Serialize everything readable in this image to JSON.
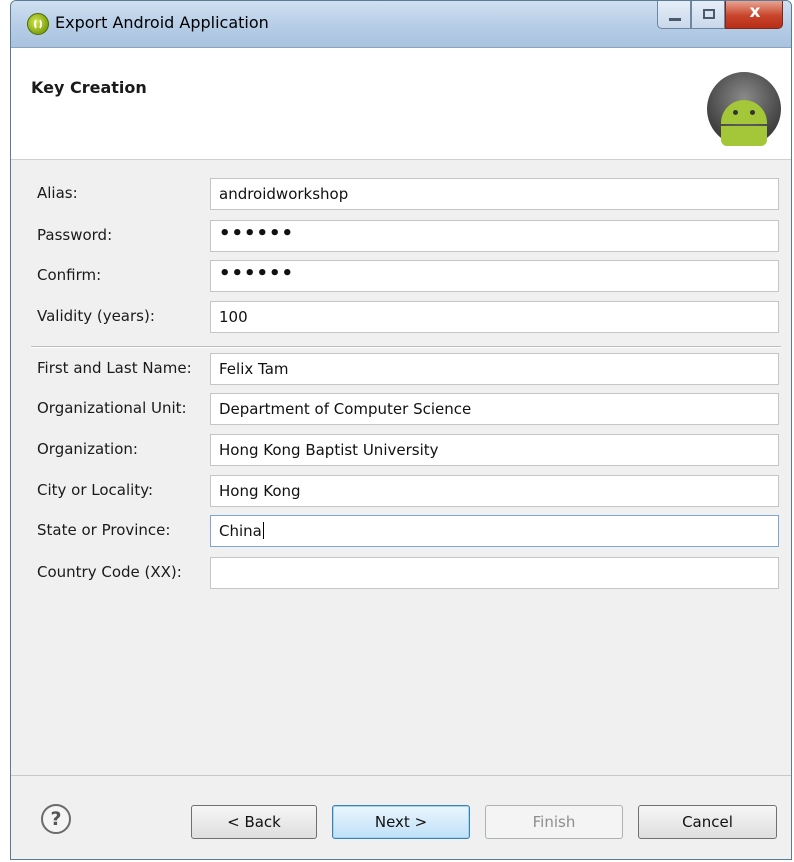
{
  "window": {
    "title": "Export Android Application",
    "icon": "android-eclipse-icon",
    "controls": {
      "minimize": "minimize-icon",
      "maximize": "maximize-icon",
      "close_glyph": "x"
    }
  },
  "header": {
    "title": "Key Creation",
    "logo": "android-robot-icon"
  },
  "form": {
    "fields": [
      {
        "label": "Alias:",
        "value": "androidworkshop"
      },
      {
        "label": "Password:",
        "value": "••••••"
      },
      {
        "label": "Confirm:",
        "value": "••••••"
      },
      {
        "label": "Validity (years):",
        "value": "100"
      },
      {
        "label": "First and Last Name:",
        "value": "Felix Tam"
      },
      {
        "label": "Organizational Unit:",
        "value": "Department of Computer Science"
      },
      {
        "label": "Organization:",
        "value": "Hong Kong Baptist University"
      },
      {
        "label": "City or Locality:",
        "value": "Hong Kong"
      },
      {
        "label": "State or Province:",
        "value": "China"
      },
      {
        "label": "Country Code (XX):",
        "value": ""
      }
    ]
  },
  "buttons": {
    "help_glyph": "?",
    "back": "< Back",
    "next": "Next >",
    "finish": "Finish",
    "cancel": "Cancel"
  },
  "colors": {
    "accent": "#3c7fb1",
    "android_green": "#a4c639",
    "title_bar": "#b6cde6"
  }
}
